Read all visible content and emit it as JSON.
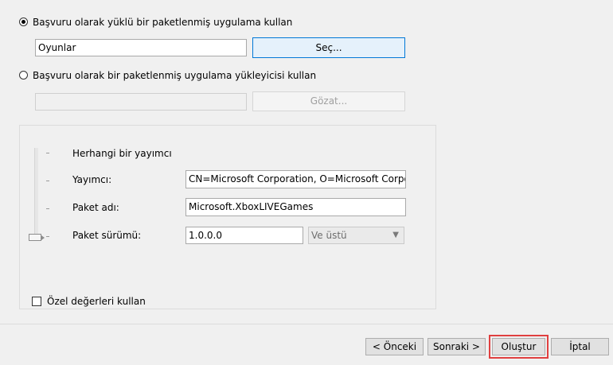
{
  "source": {
    "radio_installed_label": "Başvuru olarak yüklü bir paketlenmiş uygulama kullan",
    "installed_value": "Oyunlar",
    "select_button": "Seç...",
    "radio_installer_label": "Başvuru olarak bir paketlenmiş uygulama yükleyicisi kullan",
    "installer_value": "",
    "browse_button": "Gözat..."
  },
  "scope": {
    "levels": [
      "Herhangi bir yayımcı",
      "Yayımcı:",
      "Paket adı:",
      "Paket sürümü:"
    ],
    "selected_level": "Paket sürümü:",
    "publisher_value": "CN=Microsoft Corporation, O=Microsoft Corporati",
    "package_name_value": "Microsoft.XboxLIVEGames",
    "package_version_value": "1.0.0.0",
    "version_operator": "Ve üstü",
    "custom_values_label": "Özel değerleri kullan"
  },
  "footer": {
    "back_button": "< Önceki",
    "next_button": "Sonraki >",
    "create_button": "Oluştur",
    "cancel_button": "İptal"
  }
}
